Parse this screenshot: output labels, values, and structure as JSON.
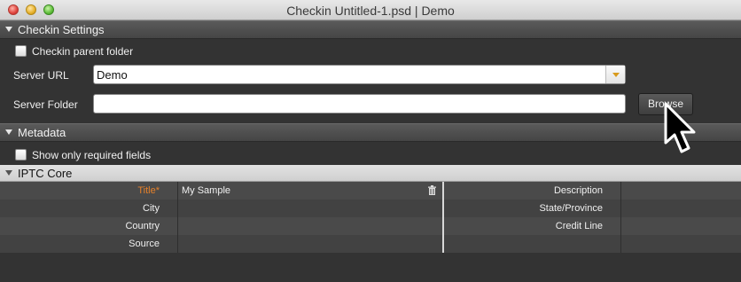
{
  "window": {
    "title": "Checkin Untitled-1.psd | Demo"
  },
  "checkin_settings": {
    "header": "Checkin Settings",
    "checkin_parent_label": "Checkin parent folder",
    "server_url_label": "Server URL",
    "server_url_value": "Demo",
    "server_folder_label": "Server Folder",
    "server_folder_value": "",
    "browse_label": "Browse"
  },
  "metadata": {
    "header": "Metadata",
    "show_required_label": "Show only required fields"
  },
  "iptc": {
    "header": "IPTC Core",
    "left_fields": [
      {
        "label": "Title",
        "required_mark": "*",
        "value": "My Sample"
      },
      {
        "label": "City",
        "value": ""
      },
      {
        "label": "Country",
        "value": ""
      },
      {
        "label": "Source",
        "value": ""
      }
    ],
    "right_fields": [
      {
        "label": "Description",
        "value": ""
      },
      {
        "label": "State/Province",
        "value": ""
      },
      {
        "label": "Credit Line",
        "value": ""
      },
      {
        "label": "",
        "value": ""
      }
    ]
  },
  "colors": {
    "required_label": "#e5802a",
    "dropdown_arrow": "#d89a1c"
  },
  "icons": [
    "close-icon",
    "minimize-icon",
    "maximize-icon",
    "disclosure-triangle-icon",
    "dropdown-arrow-icon",
    "trash-icon",
    "mouse-cursor-icon"
  ]
}
